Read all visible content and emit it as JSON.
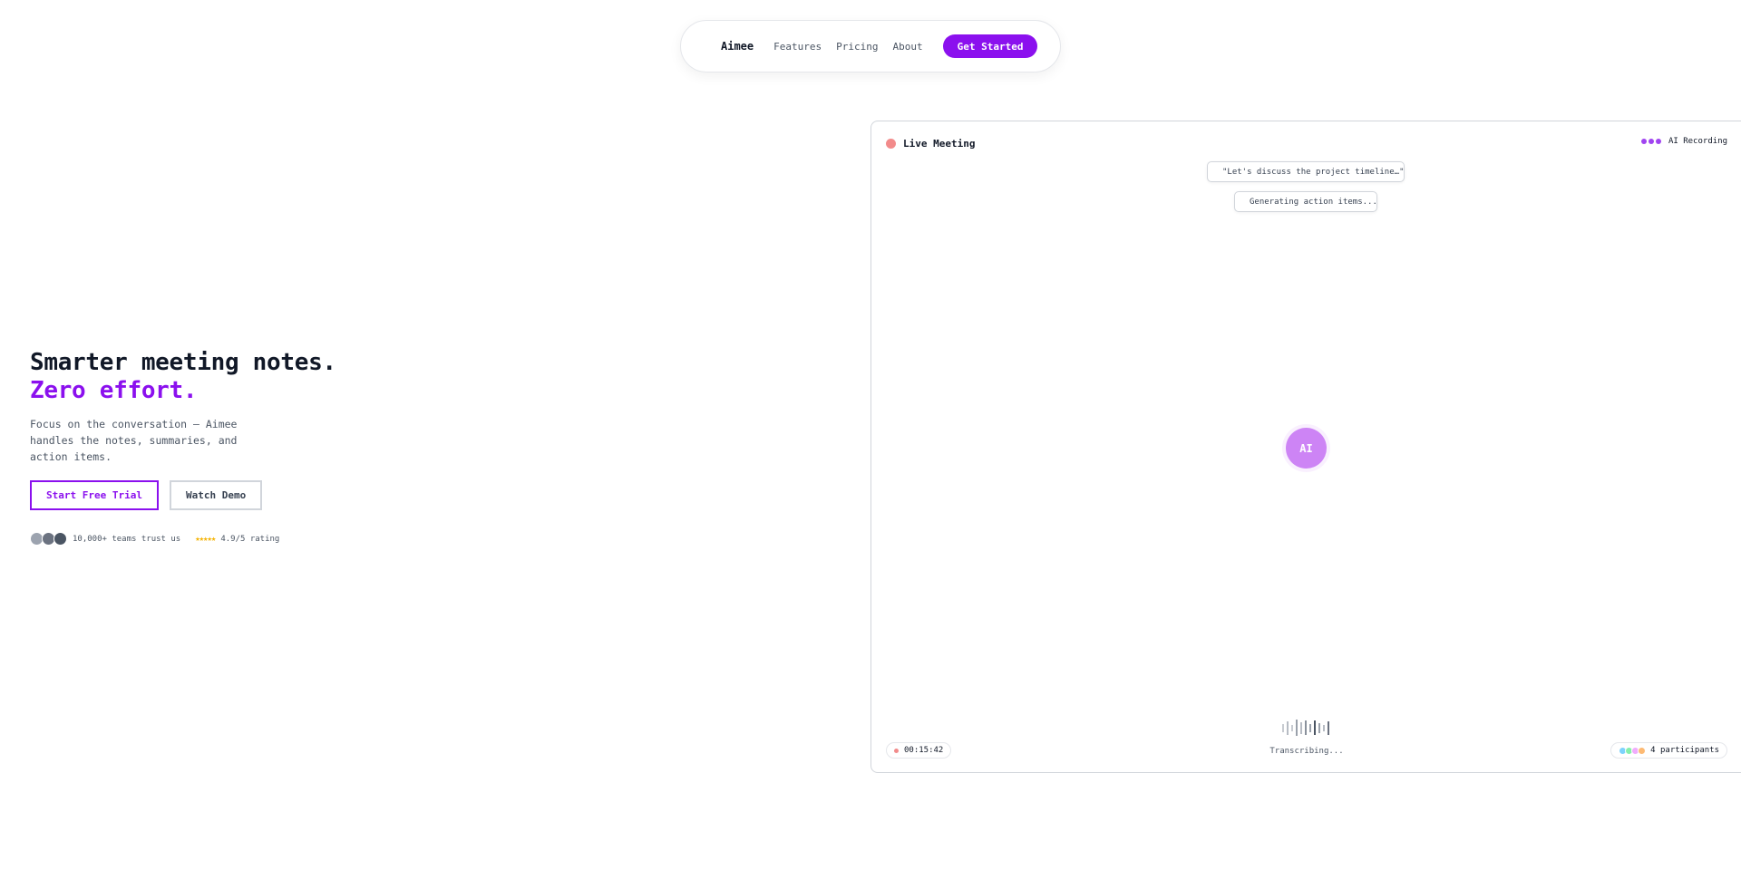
{
  "nav": {
    "brand": "Aimee",
    "links": [
      "Features",
      "Pricing",
      "About"
    ],
    "cta": "Get Started"
  },
  "hero": {
    "headline_line1": "Smarter meeting notes.",
    "headline_line2": "Zero effort.",
    "subcopy": "Focus on the conversation — Aimee handles the notes, summaries, and action items.",
    "primary_cta": "Start Free Trial",
    "secondary_cta": "Watch Demo",
    "trust_text": "10,000+ teams trust us",
    "stars": "★★★★★",
    "rating": "4.9/5 rating"
  },
  "demo": {
    "status_label": "Live Meeting",
    "recording_label": "AI Recording",
    "transcript_chip": "\"Let's discuss the project timeline…\"",
    "action_chip": "Generating action items...",
    "ai_badge": "AI",
    "timer": "00:15:42",
    "transcribing": "Transcribing...",
    "participants": "4 participants"
  },
  "colors": {
    "accent": "#8b10ee",
    "live_dot": "#f28b8b",
    "ai_orb": "#cd84f5",
    "chip_green": "#5fd3a6",
    "chip_orange": "#f97316",
    "star": "#f5b50a"
  }
}
